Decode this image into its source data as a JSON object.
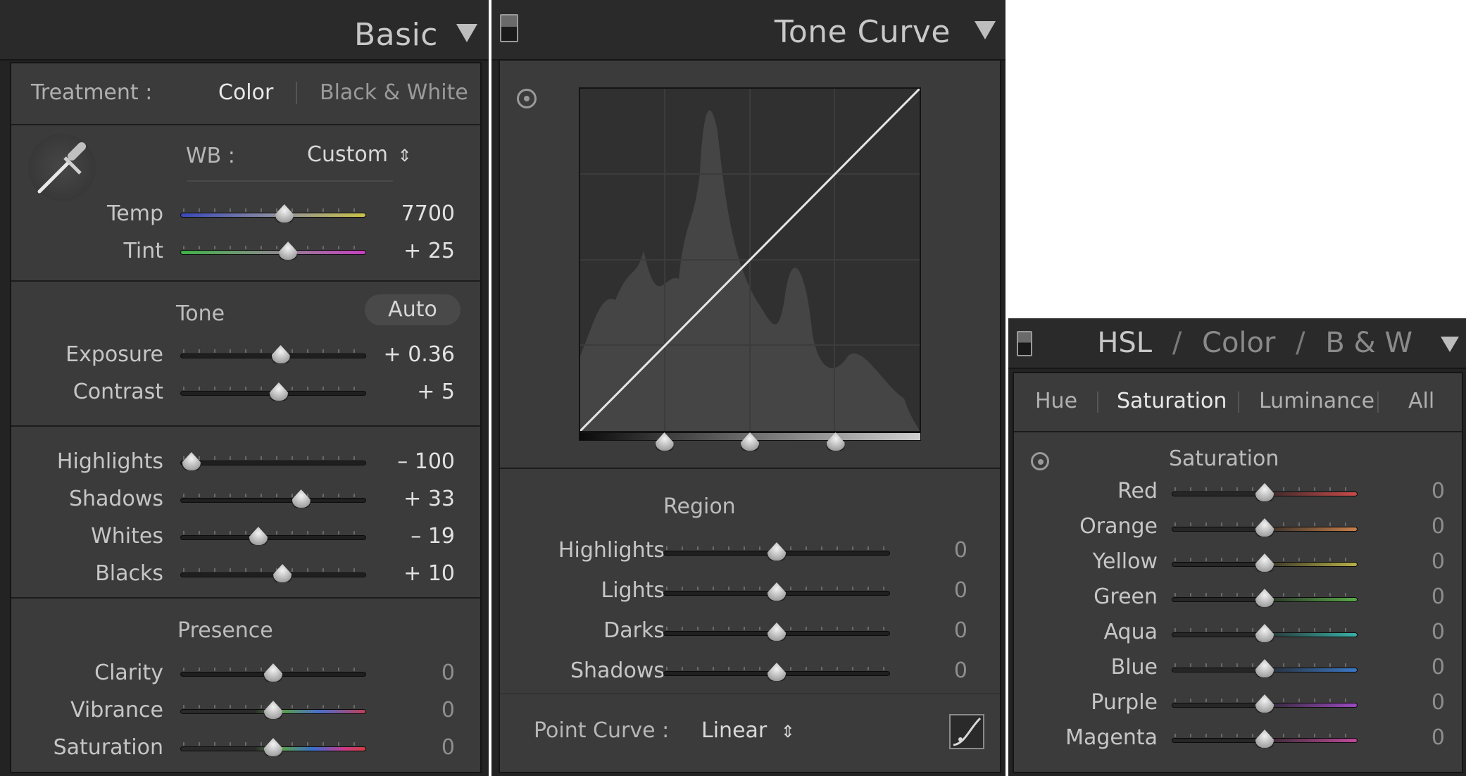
{
  "basic": {
    "title": "Basic",
    "treatment_label": "Treatment :",
    "treatment_color": "Color",
    "treatment_bw": "Black & White",
    "wb_label": "WB :",
    "wb_value": "Custom",
    "wb_arrows": "⇕",
    "tone_title": "Tone",
    "auto_label": "Auto",
    "presence_title": "Presence",
    "wb_sliders": [
      {
        "label": "Temp",
        "value": "7700",
        "pos": 0.56,
        "gradient": "linear-gradient(90deg,#3a49b8,#8c8ca0,#c9c24a)"
      },
      {
        "label": "Tint",
        "value": "+ 25",
        "pos": 0.58,
        "gradient": "linear-gradient(90deg,#3fb048,#8a8a8a,#c63fc0)"
      }
    ],
    "tone_sliders": [
      {
        "label": "Exposure",
        "value": "+ 0.36",
        "pos": 0.54
      },
      {
        "label": "Contrast",
        "value": "+ 5",
        "pos": 0.53
      }
    ],
    "region_sliders": [
      {
        "label": "Highlights",
        "value": "– 100",
        "pos": 0.06
      },
      {
        "label": "Shadows",
        "value": "+ 33",
        "pos": 0.65
      },
      {
        "label": "Whites",
        "value": "– 19",
        "pos": 0.42
      },
      {
        "label": "Blacks",
        "value": "+ 10",
        "pos": 0.55
      }
    ],
    "presence_sliders": [
      {
        "label": "Clarity",
        "value": "0",
        "pos": 0.5,
        "gradient": ""
      },
      {
        "label": "Vibrance",
        "value": "0",
        "pos": 0.5,
        "gradient": "linear-gradient(90deg,#2a2a2a 40%,#5a9d4a 55%,#4a6ec8 75%,#c03e5a)"
      },
      {
        "label": "Saturation",
        "value": "0",
        "pos": 0.5,
        "gradient": "linear-gradient(90deg,#2a2a2a 40%,#5aa04a 55%,#3a6ed0 72%,#c83a8a 88%,#d04040)"
      }
    ]
  },
  "tone_curve": {
    "title": "Tone Curve",
    "region_title": "Region",
    "sliders": [
      {
        "label": "Highlights",
        "value": "0",
        "pos": 0.5
      },
      {
        "label": "Lights",
        "value": "0",
        "pos": 0.5
      },
      {
        "label": "Darks",
        "value": "0",
        "pos": 0.5
      },
      {
        "label": "Shadows",
        "value": "0",
        "pos": 0.5
      }
    ],
    "split_points": [
      0.25,
      0.5,
      0.75
    ],
    "point_curve_label": "Point Curve :",
    "point_curve_value": "Linear",
    "point_curve_arrows": "⇕"
  },
  "hsl": {
    "title_hsl": "HSL",
    "title_slash": "/",
    "title_color": "Color",
    "title_bw": "B & W",
    "tabs": [
      "Hue",
      "Saturation",
      "Luminance",
      "All"
    ],
    "active_tab": "Saturation",
    "section_title": "Saturation",
    "sliders": [
      {
        "label": "Red",
        "value": "0",
        "pos": 0.5,
        "color": "#c84a4a"
      },
      {
        "label": "Orange",
        "value": "0",
        "pos": 0.5,
        "color": "#c8804a"
      },
      {
        "label": "Yellow",
        "value": "0",
        "pos": 0.5,
        "color": "#b8b04a"
      },
      {
        "label": "Green",
        "value": "0",
        "pos": 0.5,
        "color": "#5aa84a"
      },
      {
        "label": "Aqua",
        "value": "0",
        "pos": 0.5,
        "color": "#3ab0a8"
      },
      {
        "label": "Blue",
        "value": "0",
        "pos": 0.5,
        "color": "#3a78c8"
      },
      {
        "label": "Purple",
        "value": "0",
        "pos": 0.5,
        "color": "#9a4ac0"
      },
      {
        "label": "Magenta",
        "value": "0",
        "pos": 0.5,
        "color": "#c04a9a"
      }
    ]
  }
}
